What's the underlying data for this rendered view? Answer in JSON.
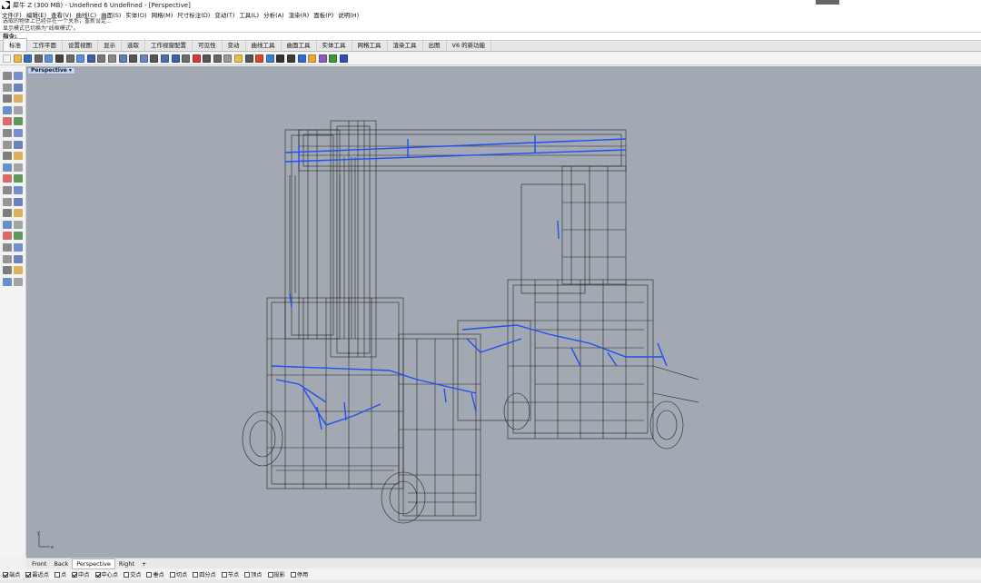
{
  "titlebar": {
    "title": "犀牛 Z (300 MB) - Undefined 6 Undefined - [Perspective]"
  },
  "menu": [
    "文件(F)",
    "编辑(E)",
    "查看(V)",
    "曲线(C)",
    "曲面(S)",
    "实体(O)",
    "网格(M)",
    "尺寸标注(D)",
    "变动(T)",
    "工具(L)",
    "分析(A)",
    "渲染(R)",
    "面板(P)",
    "说明(H)"
  ],
  "command_history": [
    "选取的物体上已经存在一个关系，重新设定...",
    "显示模式已切换为\"线框模式\"。"
  ],
  "command_prompt": "指令:",
  "tabs": [
    {
      "label": "标准",
      "active": true
    },
    {
      "label": "工作平面",
      "active": false
    },
    {
      "label": "设置视图",
      "active": false
    },
    {
      "label": "显示",
      "active": false
    },
    {
      "label": "选取",
      "active": false
    },
    {
      "label": "工作视窗配置",
      "active": false
    },
    {
      "label": "可见性",
      "active": false
    },
    {
      "label": "变动",
      "active": false
    },
    {
      "label": "曲线工具",
      "active": false
    },
    {
      "label": "曲面工具",
      "active": false
    },
    {
      "label": "实体工具",
      "active": false
    },
    {
      "label": "网格工具",
      "active": false
    },
    {
      "label": "渲染工具",
      "active": false
    },
    {
      "label": "出图",
      "active": false
    },
    {
      "label": "V6 的新功能",
      "active": false
    }
  ],
  "toolbar_icons": [
    "new-icon",
    "open-icon",
    "save-icon",
    "print-icon",
    "import-icon",
    "cut-icon",
    "copy-icon",
    "paste-icon",
    "undo-icon",
    "pan-icon",
    "move-view-icon",
    "rotate-view-icon",
    "zoom-icon",
    "zoom-window-icon",
    "zoom-extents-icon",
    "zoom-selected-icon",
    "undo-view-icon",
    "four-views-icon",
    "cplane-icon",
    "grid-icon",
    "layer-icon",
    "properties-icon",
    "lights-icon",
    "point-on-icon",
    "select-color-icon",
    "shade-icon",
    "render-icon",
    "material-icon",
    "environment-icon",
    "tools-icon",
    "options-icon",
    "filter-icon",
    "help-icon"
  ],
  "toolbar_colors": [
    "#f4f4f4",
    "#e8b84a",
    "#3a6db8",
    "#666666",
    "#5b8fd6",
    "#444444",
    "#6a6a6a",
    "#5b8fd6",
    "#3b5fa8",
    "#777777",
    "#888888",
    "#5f7fb6",
    "#555555",
    "#6a86b8",
    "#555555",
    "#4f6ea8",
    "#3b5fa8",
    "#6b6b6b",
    "#d33b3b",
    "#555555",
    "#666666",
    "#999999",
    "#e2c04a",
    "#555555",
    "#d9472b",
    "#3a7fc7",
    "#333333",
    "#3b3b3b",
    "#2a6fcf",
    "#e2a93a",
    "#8e5bbd",
    "#3a9a3a",
    "#3050b8"
  ],
  "left_tools_count": 38,
  "viewport": {
    "title": "Perspective",
    "background": "#a3a9b2",
    "wire_color": "#141414",
    "highlight_color": "#1f4ff2"
  },
  "axis": {
    "x": "x",
    "y": "y"
  },
  "view_tabs": [
    {
      "label": "Front",
      "active": false
    },
    {
      "label": "Back",
      "active": false
    },
    {
      "label": "Perspective",
      "active": true
    },
    {
      "label": "Right",
      "active": false
    }
  ],
  "osnap": [
    {
      "label": "端点",
      "checked": true
    },
    {
      "label": "最近点",
      "checked": true
    },
    {
      "label": "点",
      "checked": false
    },
    {
      "label": "中点",
      "checked": true
    },
    {
      "label": "中心点",
      "checked": true
    },
    {
      "label": "交点",
      "checked": false
    },
    {
      "label": "垂点",
      "checked": false
    },
    {
      "label": "切点",
      "checked": false
    },
    {
      "label": "四分点",
      "checked": false
    },
    {
      "label": "节点",
      "checked": false
    },
    {
      "label": "顶点",
      "checked": false
    },
    {
      "label": "投影",
      "checked": false
    },
    {
      "label": "停用",
      "checked": false
    }
  ]
}
